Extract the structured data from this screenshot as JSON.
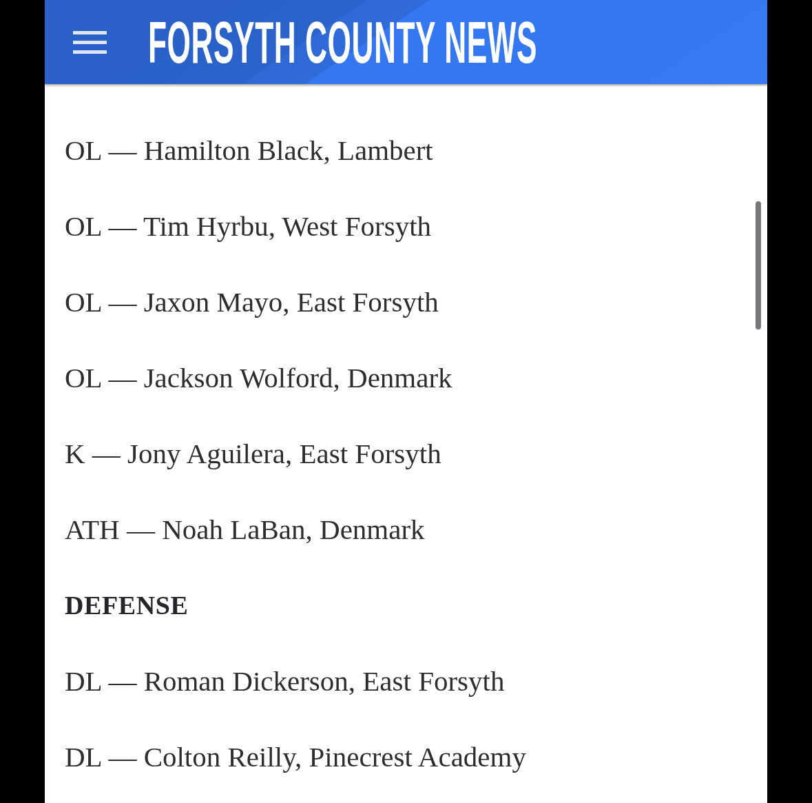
{
  "header": {
    "title": "FORSYTH COUNTY NEWS"
  },
  "article": {
    "items": [
      {
        "kind": "entry",
        "text": "OL — Hamilton Black, Lambert"
      },
      {
        "kind": "entry",
        "text": "OL — Tim Hyrbu, West Forsyth"
      },
      {
        "kind": "entry",
        "text": "OL — Jaxon Mayo, East Forsyth"
      },
      {
        "kind": "entry",
        "text": "OL — Jackson Wolford, Denmark"
      },
      {
        "kind": "entry",
        "text": "K — Jony Aguilera, East Forsyth"
      },
      {
        "kind": "entry",
        "text": "ATH — Noah LaBan, Denmark"
      },
      {
        "kind": "heading",
        "text": "DEFENSE"
      },
      {
        "kind": "entry",
        "text": "DL — Roman Dickerson, East Forsyth"
      },
      {
        "kind": "entry",
        "text": "DL — Colton Reilly, Pinecrest Academy"
      }
    ]
  }
}
